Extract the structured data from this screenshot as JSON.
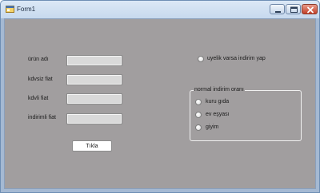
{
  "window": {
    "title": "Form1"
  },
  "fields": [
    {
      "label": "ürün adı",
      "value": ""
    },
    {
      "label": "kdvsiz fiat",
      "value": ""
    },
    {
      "label": "kdvli fiat",
      "value": ""
    },
    {
      "label": "indirimli fiat",
      "value": ""
    }
  ],
  "button": {
    "label": "Tıkla"
  },
  "membership": {
    "label": "uyelik varsa indirim yap",
    "checked": false
  },
  "discount_group": {
    "title": "normal indirim oranı",
    "options": [
      {
        "label": "kuru gıda",
        "checked": false
      },
      {
        "label": "ev eşyası",
        "checked": false
      },
      {
        "label": "giyim",
        "checked": false
      }
    ]
  },
  "colors": {
    "client_background": "#a19e9f",
    "titlebar": "#c7d9ee",
    "close_button": "#c2402a"
  }
}
